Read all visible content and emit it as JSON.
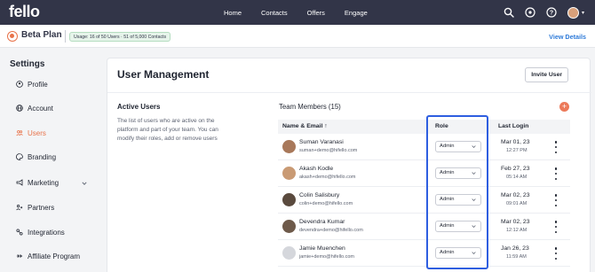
{
  "app": {
    "logo": "fello"
  },
  "nav": {
    "links": [
      "Home",
      "Contacts",
      "Offers",
      "Engage"
    ]
  },
  "nav_icons": [
    "search-icon",
    "pin-icon",
    "help-icon",
    "avatar"
  ],
  "plan": {
    "title": "Beta Plan",
    "usage": "Usage: 16 of 50 Users · 51 of 5,000 Contacts",
    "view_details": "View Details"
  },
  "sidebar": {
    "title": "Settings",
    "items": [
      {
        "label": "Profile",
        "icon": "user-circle-icon"
      },
      {
        "label": "Account",
        "icon": "globe-icon"
      },
      {
        "label": "Users",
        "icon": "users-icon",
        "active": true
      },
      {
        "label": "Branding",
        "icon": "palette-icon"
      },
      {
        "label": "Marketing",
        "icon": "megaphone-icon",
        "expandable": true
      },
      {
        "label": "Partners",
        "icon": "handshake-icon"
      },
      {
        "label": "Integrations",
        "icon": "plug-icon"
      },
      {
        "label": "Affiliate Program",
        "icon": "link-icon"
      }
    ]
  },
  "main": {
    "title": "User Management",
    "invite_button": "Invite User",
    "active_users_title": "Active Users",
    "active_users_desc": "The list of users who are active on the platform and part of your team. You can modify their roles, add or remove users",
    "team_title": "Team Members (15)",
    "columns": {
      "name_email": "Name & Email ↑",
      "role": "Role",
      "last_login": "Last Login"
    },
    "members": [
      {
        "name": "Suman Varanasi",
        "email": "suman+demo@hifello.com",
        "role": "Admin",
        "date": "Mar 01, 23",
        "time": "12:27 PM",
        "avatar_color": "#a8785a"
      },
      {
        "name": "Akash Kodle",
        "email": "akash+demo@hifello.com",
        "role": "Admin",
        "date": "Feb 27, 23",
        "time": "05:14 AM",
        "avatar_color": "#c99a74"
      },
      {
        "name": "Colin Salisbury",
        "email": "colin+demo@hifello.com",
        "role": "Admin",
        "date": "Mar 02, 23",
        "time": "09:01 AM",
        "avatar_color": "#5a4a3e"
      },
      {
        "name": "Devendra Kumar",
        "email": "devendra+demo@hifello.com",
        "role": "Admin",
        "date": "Mar 02, 23",
        "time": "12:12 AM",
        "avatar_color": "#6e5a4a"
      },
      {
        "name": "Jamie Muenchen",
        "email": "jamie+demo@hifello.com",
        "role": "Admin",
        "date": "Jan 26, 23",
        "time": "11:59 AM",
        "avatar_color": "#d5d7dc"
      }
    ]
  },
  "colors": {
    "nav_bg": "#323548",
    "accent": "#e8734a",
    "link": "#2f7bd9",
    "highlight": "#2e5ee0"
  }
}
